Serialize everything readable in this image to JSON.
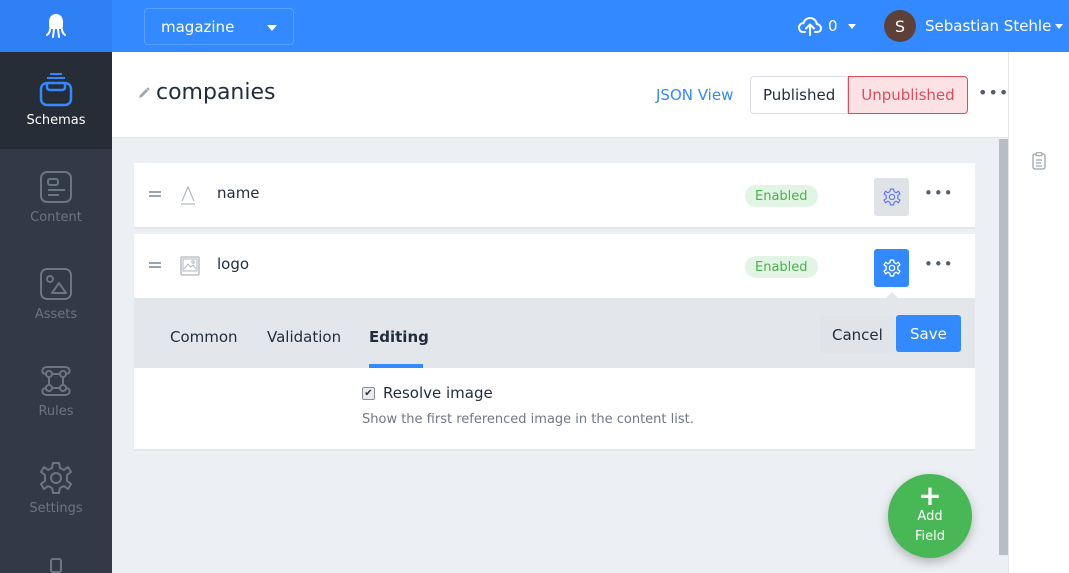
{
  "topbar": {
    "app_selector": "magazine",
    "uploads_count": "0",
    "user": {
      "initial": "S",
      "name": "Sebastian Stehle",
      "avatar_color": "#5d4037"
    },
    "brand_color": "#3389ff"
  },
  "sidebar": {
    "items": [
      {
        "label": "Schemas",
        "icon": "schemas-icon",
        "active": true
      },
      {
        "label": "Content",
        "icon": "content-icon",
        "active": false
      },
      {
        "label": "Assets",
        "icon": "assets-icon",
        "active": false
      },
      {
        "label": "Rules",
        "icon": "rules-icon",
        "active": false
      },
      {
        "label": "Settings",
        "icon": "settings-icon",
        "active": false
      }
    ]
  },
  "header": {
    "title": "companies",
    "json_view": "JSON View",
    "published": "Published",
    "unpublished": "Unpublished",
    "unpublished_active": true
  },
  "fields": [
    {
      "name": "name",
      "type_icon": "string-icon",
      "status": "Enabled",
      "settings_open": false
    },
    {
      "name": "logo",
      "type_icon": "image-icon",
      "status": "Enabled",
      "settings_open": true
    }
  ],
  "editor": {
    "tabs": [
      "Common",
      "Validation",
      "Editing"
    ],
    "active_tab": "Editing",
    "cancel": "Cancel",
    "save": "Save",
    "option_label": "Resolve image",
    "option_checked": true,
    "option_hint": "Show the first referenced image in the content list."
  },
  "fab": {
    "plus": "+",
    "line1": "Add",
    "line2": "Field",
    "color": "#48b857"
  }
}
